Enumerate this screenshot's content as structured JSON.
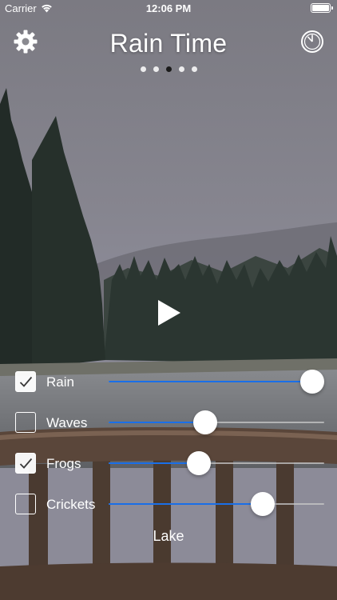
{
  "status_bar": {
    "carrier": "Carrier",
    "time": "12:06 PM"
  },
  "header": {
    "title": "Rain Time",
    "settings_icon": "gear-icon",
    "timer_icon": "stopwatch-icon",
    "pages": 5,
    "active_page": 3
  },
  "player": {
    "play_icon": "play-icon"
  },
  "sounds": [
    {
      "label": "Rain",
      "checked": true,
      "volume": 1.0
    },
    {
      "label": "Waves",
      "checked": false,
      "volume": 0.44
    },
    {
      "label": "Frogs",
      "checked": true,
      "volume": 0.41
    },
    {
      "label": "Crickets",
      "checked": false,
      "volume": 0.74
    }
  ],
  "scene": {
    "name": "Lake"
  },
  "colors": {
    "slider_fill": "#1a6fe8",
    "slider_track": "#c8c8c8",
    "active_dot": "#1a1a1a"
  }
}
